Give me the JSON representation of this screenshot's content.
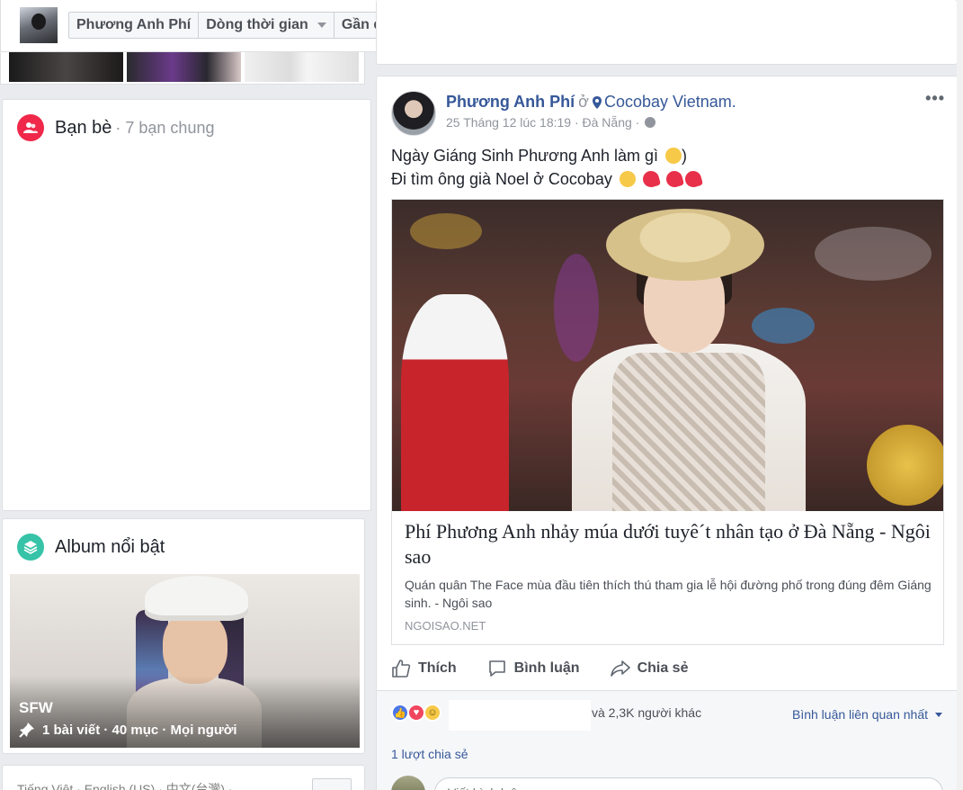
{
  "header": {
    "nav": [
      {
        "label": "Phương Anh Phí"
      },
      {
        "label": "Dòng thời gian"
      },
      {
        "label": "Gần đây"
      }
    ]
  },
  "friends": {
    "title": "Bạn bè",
    "subtitle": "· 7 bạn chung"
  },
  "album": {
    "title": "Album nổi bật",
    "name": "SFW",
    "meta": "1 bài viết · 40 mục · Mọi người"
  },
  "footer": {
    "languages": "Tiếng Việt · English (US) · 中文(台灣) ·"
  },
  "post": {
    "author": "Phương Anh Phí",
    "at": "ở",
    "place": "Cocobay Vietnam.",
    "time": "25 Tháng 12 lúc 18:19 · Đà Nẵng ·",
    "line1": "Ngày Giáng Sinh Phương Anh làm gì",
    "line1_end": ")",
    "line2": "Đi tìm ông già Noel ở Cocobay",
    "link": {
      "title": "Phí Phương Anh nhảy múa dưới tuyê´t nhân tạo ở Đà Nẵng - Ngôi sao",
      "description": "Quán quân The Face mùa đầu tiên thích thú tham gia lễ hội đường phố trong đúng đêm Giáng sinh. - Ngôi sao",
      "domain": "NGOISAO.NET"
    },
    "actions": {
      "like": "Thích",
      "comment": "Bình luận",
      "share": "Chia sẻ"
    },
    "reactions": {
      "text": "và 2,3K người khác",
      "sort": "Bình luận liên quan nhất"
    },
    "shares": "1 lượt chia sẻ",
    "comment_placeholder": "Viết bình luận..."
  },
  "colors": {
    "accent": "#365899",
    "friends_icon": "#f02849",
    "album_icon": "#36c3a8",
    "background": "#e9ebee"
  }
}
